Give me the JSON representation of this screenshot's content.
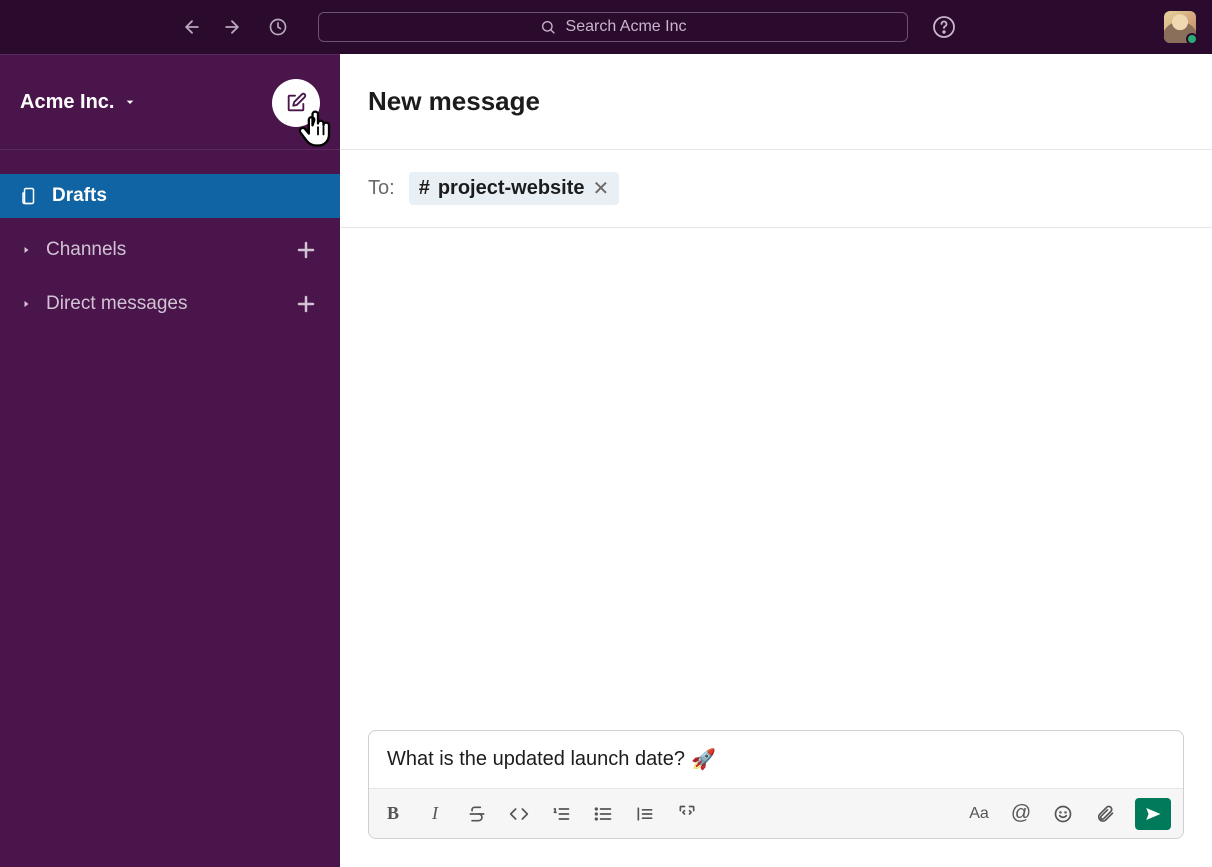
{
  "topbar": {
    "search_placeholder": "Search Acme Inc"
  },
  "workspace": {
    "name": "Acme Inc."
  },
  "sidebar": {
    "drafts_label": "Drafts",
    "sections": [
      {
        "label": "Channels"
      },
      {
        "label": "Direct messages"
      }
    ]
  },
  "content": {
    "title": "New message",
    "to_label": "To:",
    "recipient_chip": {
      "prefix": "#",
      "name": "project-website"
    }
  },
  "composer": {
    "text": "What is the updated launch date?",
    "emoji": "🚀"
  }
}
